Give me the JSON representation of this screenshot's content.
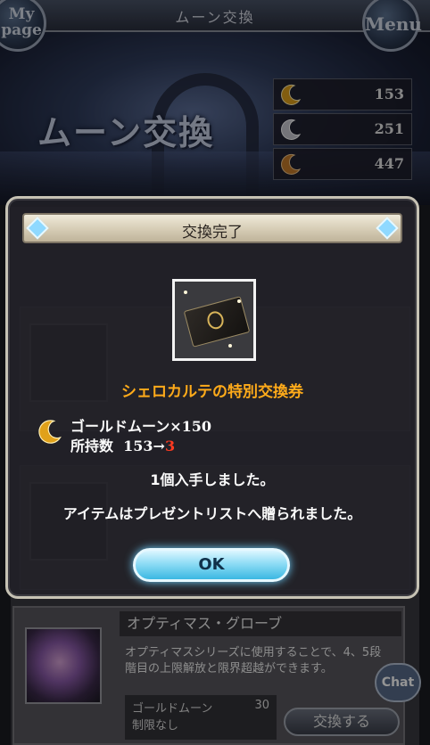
{
  "header": {
    "title": "ムーン交換",
    "mypage_line1": "My",
    "mypage_line2": "page",
    "menu_label": "Menu"
  },
  "page_heading": "ムーン交換",
  "moons": [
    {
      "name": "gold-moon",
      "count": "153",
      "color": "#e0a11a"
    },
    {
      "name": "silver-moon",
      "count": "251",
      "color": "#c8c8d0"
    },
    {
      "name": "bronze-moon",
      "count": "447",
      "color": "#c47a2a"
    }
  ],
  "modal": {
    "title": "交換完了",
    "item_name": "シェロカルテの特別交換券",
    "cost_text": "ゴールドムーン×150",
    "owned_label": "所持数",
    "owned_before": "153→",
    "owned_after": "3",
    "message1": "1個入手しました。",
    "message2": "アイテムはプレゼントリストへ贈られました。",
    "ok_label": "OK"
  },
  "background_list": {
    "optimus": {
      "name": "オプティマス・グローブ",
      "description": "オプティマスシリーズに使用することで、4、5段階目の上限解放と限界超越ができます。",
      "cost_label": "ゴールドムーン",
      "cost_value": "30",
      "limit": "制限なし",
      "exchange_label": "交換する"
    }
  },
  "chat_label": "Chat",
  "colors": {
    "item_name": "#ffab1a",
    "after_count": "#ff3a20",
    "ok_button": "#8fdcf5"
  }
}
